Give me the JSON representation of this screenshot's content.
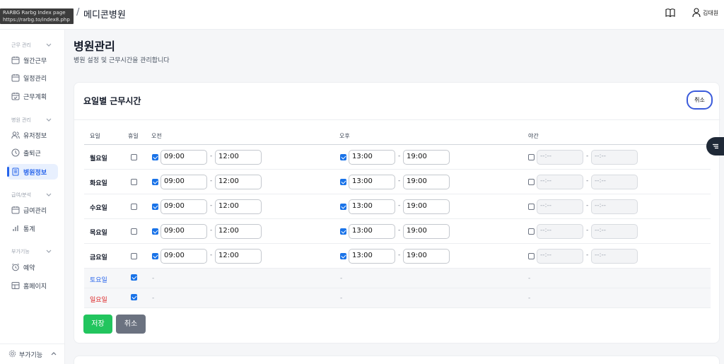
{
  "tooltip": {
    "title": "RARBG Rarbg Index page",
    "url": "https://rarbg.to/index8.php"
  },
  "header": {
    "logo_fragment": "",
    "separator": "/",
    "title": "메디콘병원",
    "user_name": "김대원"
  },
  "sidebar": {
    "sections": [
      {
        "title": "근무 관리",
        "items": [
          {
            "label": "월간근무",
            "icon": "calendar-icon"
          },
          {
            "label": "일정관리",
            "icon": "calendar-edit-icon"
          },
          {
            "label": "근무계획",
            "icon": "calendar-check-icon"
          }
        ]
      },
      {
        "title": "병원 관리",
        "items": [
          {
            "label": "유저정보",
            "icon": "users-icon"
          },
          {
            "label": "출퇴근",
            "icon": "clock-icon"
          },
          {
            "label": "병원정보",
            "icon": "building-icon",
            "active": true
          }
        ]
      },
      {
        "title": "급여/분석",
        "items": [
          {
            "label": "급여관리",
            "icon": "calendar-icon"
          },
          {
            "label": "통계",
            "icon": "bar-chart-icon"
          }
        ]
      },
      {
        "title": "부가기능",
        "items": [
          {
            "label": "예약",
            "icon": "alarm-icon"
          },
          {
            "label": "홈페이지",
            "icon": "layout-icon"
          }
        ]
      }
    ],
    "footer_label": "부가기능"
  },
  "page": {
    "title": "병원관리",
    "subtitle": "병원 설정 및 근무시간을 관리합니다"
  },
  "card": {
    "title": "요일별 근무시간",
    "cancel_label": "취소",
    "columns": {
      "day": "요일",
      "holiday": "휴일",
      "morning": "오전",
      "afternoon": "오후",
      "night": "야간"
    },
    "rows": [
      {
        "day": "월요일",
        "holiday": false,
        "morning": {
          "on": true,
          "start": "09:00",
          "end": "12:00"
        },
        "afternoon": {
          "on": true,
          "start": "13:00",
          "end": "19:00"
        },
        "night": {
          "on": false,
          "start": "--:--",
          "end": "--:--"
        }
      },
      {
        "day": "화요일",
        "holiday": false,
        "morning": {
          "on": true,
          "start": "09:00",
          "end": "12:00"
        },
        "afternoon": {
          "on": true,
          "start": "13:00",
          "end": "19:00"
        },
        "night": {
          "on": false,
          "start": "--:--",
          "end": "--:--"
        }
      },
      {
        "day": "수요일",
        "holiday": false,
        "morning": {
          "on": true,
          "start": "09:00",
          "end": "12:00"
        },
        "afternoon": {
          "on": true,
          "start": "13:00",
          "end": "19:00"
        },
        "night": {
          "on": false,
          "start": "--:--",
          "end": "--:--"
        }
      },
      {
        "day": "목요일",
        "holiday": false,
        "morning": {
          "on": true,
          "start": "09:00",
          "end": "12:00"
        },
        "afternoon": {
          "on": true,
          "start": "13:00",
          "end": "19:00"
        },
        "night": {
          "on": false,
          "start": "--:--",
          "end": "--:--"
        }
      },
      {
        "day": "금요일",
        "holiday": false,
        "morning": {
          "on": true,
          "start": "09:00",
          "end": "12:00"
        },
        "afternoon": {
          "on": true,
          "start": "13:00",
          "end": "19:00"
        },
        "night": {
          "on": false,
          "start": "--:--",
          "end": "--:--"
        }
      }
    ],
    "weekend_rows": [
      {
        "day": "토요일",
        "holiday": true,
        "morning": "-",
        "afternoon": "-",
        "night": "-",
        "color": "#2563eb"
      },
      {
        "day": "일요일",
        "holiday": true,
        "morning": "-",
        "afternoon": "-",
        "night": "-",
        "color": "#dc2626"
      }
    ],
    "time_separator": "-",
    "save_label": "저장",
    "bottom_cancel_label": "취소"
  },
  "colors": {
    "accent": "#2563eb",
    "save": "#22c55e",
    "cancel": "#6b7280"
  }
}
